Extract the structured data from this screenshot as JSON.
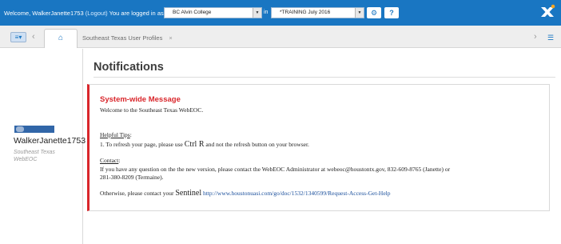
{
  "header": {
    "welcome_prefix": "Welcome, WalkerJanette1753",
    "logout": "(Logout)",
    "logged_in_as": "You are logged in as",
    "position_value": "BC Alvin College",
    "in_label": "in",
    "incident_value": "*TRAINING July 2016",
    "settings_icon": "gear-icon",
    "help_icon": "help-icon",
    "logo_icon": "webeoc-logo-icon"
  },
  "tabs": {
    "menu_icon": "menu-icon",
    "prev_icon": "chevron-left-icon",
    "home_icon": "home-icon",
    "active_tab_label": "Southeast Texas User Profiles",
    "close_symbol": "×",
    "next_icon": "chevron-right-icon",
    "list_icon": "list-icon"
  },
  "user_panel": {
    "badge_text": "Southeast Texas Regional WebEOC",
    "username": "WalkerJanette1753",
    "org_line1": "Southeast Texas",
    "org_line2": "WebEOC"
  },
  "notifications": {
    "heading": "Notifications",
    "message_title": "System-wide Message",
    "welcome_line": "Welcome to the Southeast Texas WebEOC.",
    "tips_heading": "Helpful Tips",
    "tips_colon": ":",
    "tip1_a": "1.  To refresh your page, please use ",
    "tip1_key": "Ctrl R",
    "tip1_b": " and not the refresh button on your browser.",
    "contact_heading": "Contact",
    "contact_colon": ":",
    "contact_line1": "If you have any question on the the new version, please contact the WebEOC Administrator at webeoc@houstontx.gov, 832-609-8765 (Janette) or",
    "contact_line2": "281-380-8209 (Termaine).",
    "otherwise_prefix": "Otherwise, please contact your ",
    "sentinel": "Sentinel",
    "sentinel_link": "http://www.houstonuasi.com/go/doc/1532/1340599/Request-Access-Get-Help"
  }
}
